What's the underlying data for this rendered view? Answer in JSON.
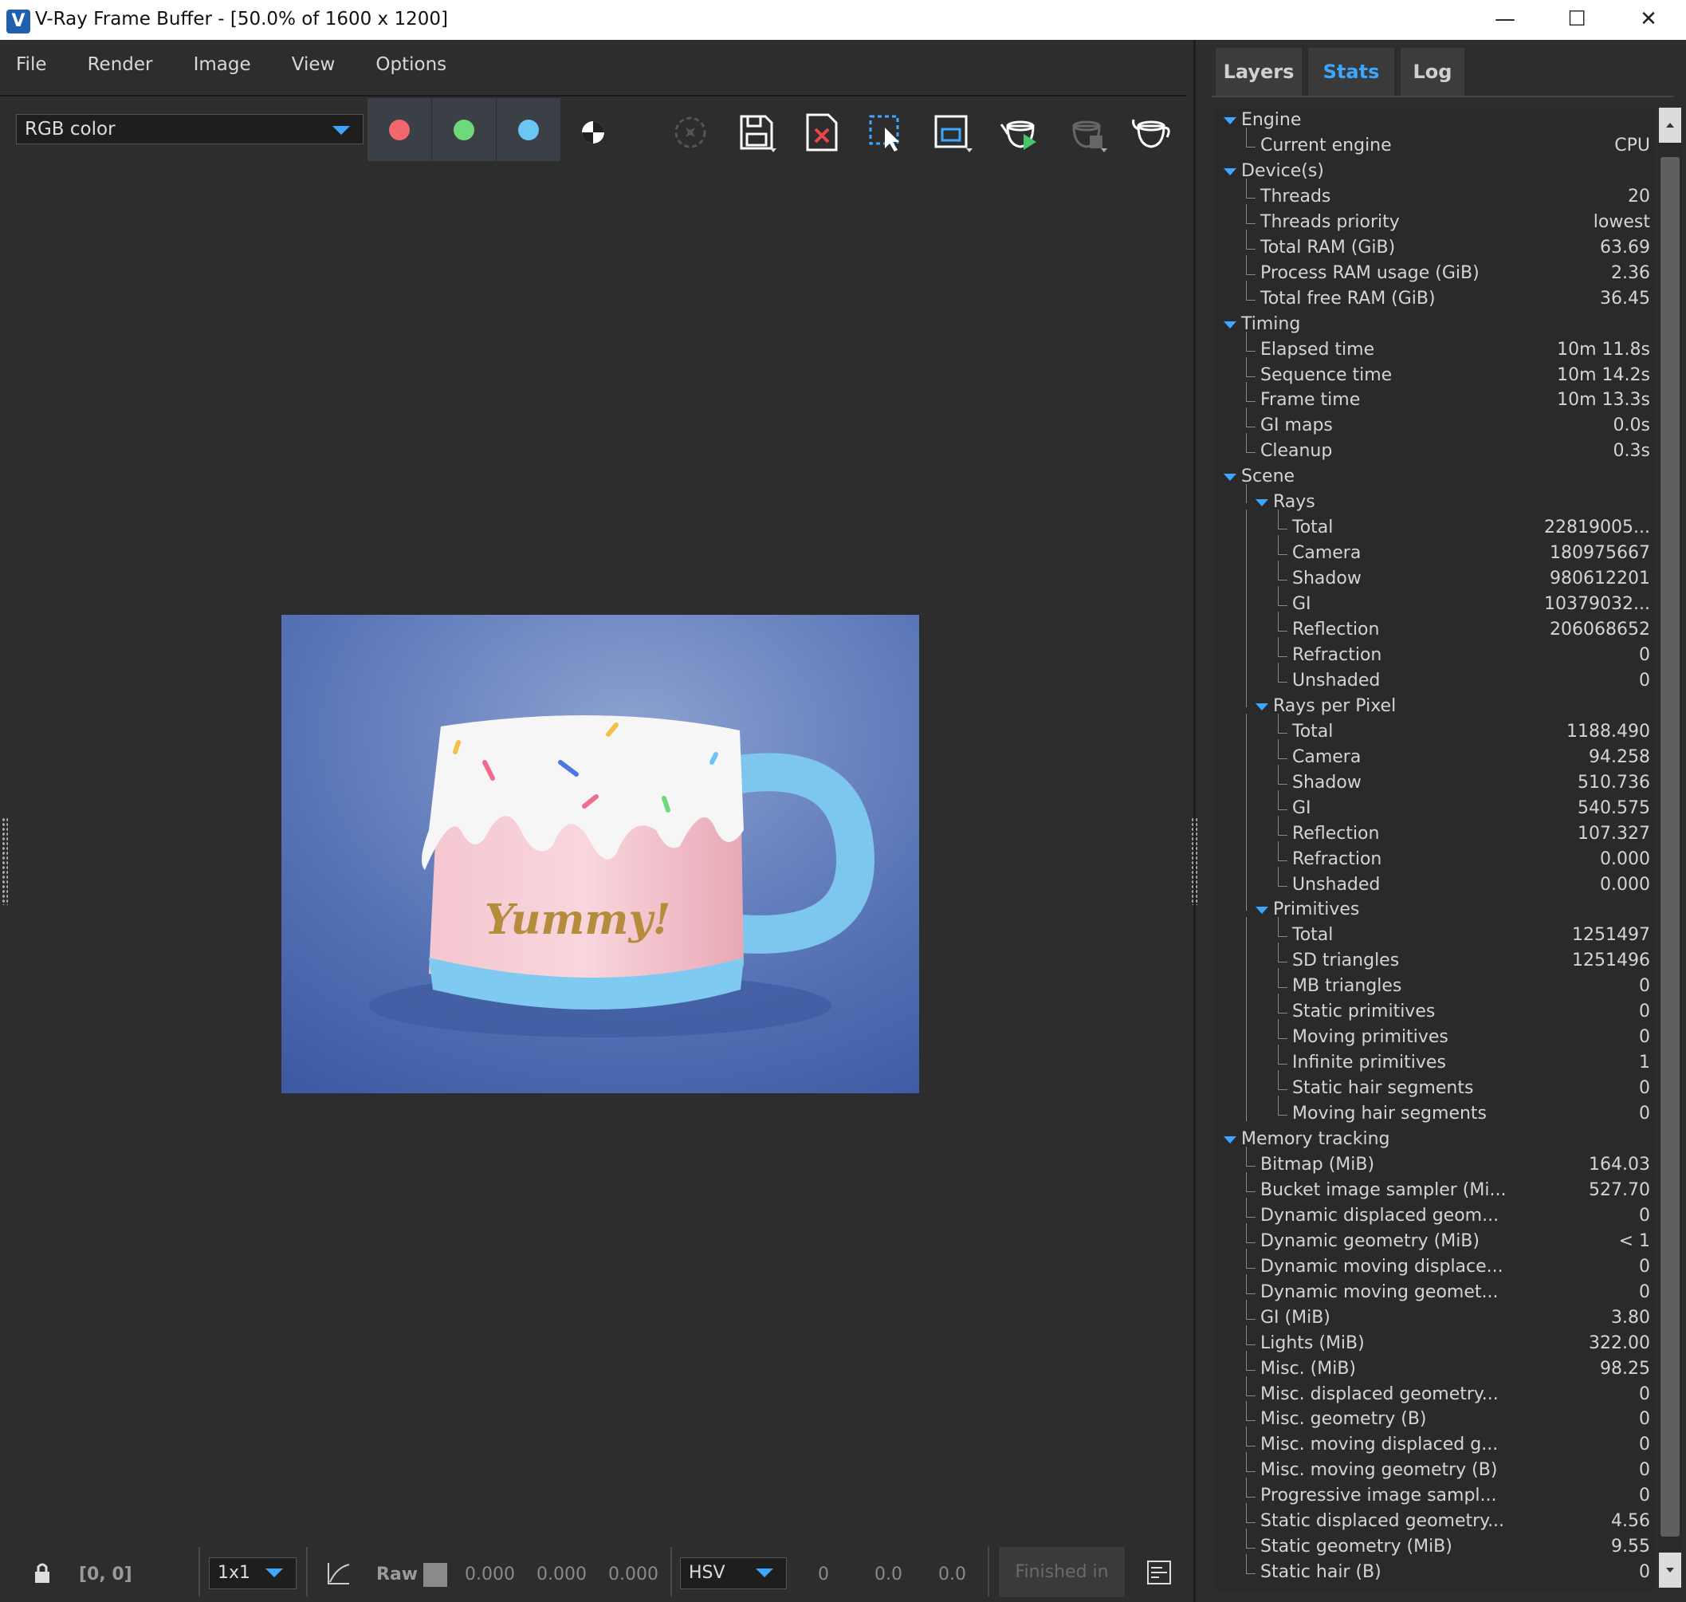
{
  "window": {
    "title": "V-Ray Frame Buffer - [50.0% of 1600 x 1200]",
    "minimize": "—",
    "maximize": "☐",
    "close": "✕"
  },
  "menu": [
    "File",
    "Render",
    "Image",
    "View",
    "Options"
  ],
  "toolbar": {
    "channel": "RGB color",
    "colors": {
      "red": "#f0686c",
      "green": "#6ed87a",
      "blue": "#6cc6f4"
    },
    "icons": [
      "mono-icon",
      "lens-effects-icon",
      "save-icon",
      "clear-icon",
      "region-select-icon",
      "region-render-icon",
      "render-interactive-icon",
      "render-stop-icon",
      "render-icon"
    ]
  },
  "render_image": {
    "text": "Yummy!"
  },
  "status": {
    "coords": "[0, 0]",
    "zoom": "1x1",
    "raw_label": "Raw",
    "r": "0.000",
    "g": "0.000",
    "b": "0.000",
    "color_mode": "HSV",
    "h": "0",
    "s": "0.0",
    "v": "0.0",
    "finished": "Finished in"
  },
  "tabs": [
    {
      "label": "Layers",
      "active": false
    },
    {
      "label": "Stats",
      "active": true
    },
    {
      "label": "Log",
      "active": false
    }
  ],
  "stats": [
    {
      "label": "Engine",
      "value": "",
      "level": 0,
      "group": true
    },
    {
      "label": "Current engine",
      "value": "CPU",
      "level": 1
    },
    {
      "label": "Device(s)",
      "value": "",
      "level": 0,
      "group": true
    },
    {
      "label": "Threads",
      "value": "20",
      "level": 1
    },
    {
      "label": "Threads priority",
      "value": "lowest",
      "level": 1
    },
    {
      "label": "Total RAM (GiB)",
      "value": "63.69",
      "level": 1
    },
    {
      "label": "Process RAM usage (GiB)",
      "value": "2.36",
      "level": 1
    },
    {
      "label": "Total free RAM (GiB)",
      "value": "36.45",
      "level": 1
    },
    {
      "label": "Timing",
      "value": "",
      "level": 0,
      "group": true
    },
    {
      "label": "Elapsed time",
      "value": "10m 11.8s",
      "level": 1
    },
    {
      "label": "Sequence time",
      "value": "10m 14.2s",
      "level": 1
    },
    {
      "label": "Frame time",
      "value": "10m 13.3s",
      "level": 1
    },
    {
      "label": "GI maps",
      "value": "0.0s",
      "level": 1
    },
    {
      "label": "Cleanup",
      "value": "0.3s",
      "level": 1
    },
    {
      "label": "Scene",
      "value": "",
      "level": 0,
      "group": true
    },
    {
      "label": "Rays",
      "value": "",
      "level": 1,
      "group": true
    },
    {
      "label": "Total",
      "value": "22819005...",
      "level": 2
    },
    {
      "label": "Camera",
      "value": "180975667",
      "level": 2
    },
    {
      "label": "Shadow",
      "value": "980612201",
      "level": 2
    },
    {
      "label": "GI",
      "value": "10379032...",
      "level": 2
    },
    {
      "label": "Reflection",
      "value": "206068652",
      "level": 2
    },
    {
      "label": "Refraction",
      "value": "0",
      "level": 2
    },
    {
      "label": "Unshaded",
      "value": "0",
      "level": 2
    },
    {
      "label": "Rays per Pixel",
      "value": "",
      "level": 1,
      "group": true
    },
    {
      "label": "Total",
      "value": "1188.490",
      "level": 2
    },
    {
      "label": "Camera",
      "value": "94.258",
      "level": 2
    },
    {
      "label": "Shadow",
      "value": "510.736",
      "level": 2
    },
    {
      "label": "GI",
      "value": "540.575",
      "level": 2
    },
    {
      "label": "Reflection",
      "value": "107.327",
      "level": 2
    },
    {
      "label": "Refraction",
      "value": "0.000",
      "level": 2
    },
    {
      "label": "Unshaded",
      "value": "0.000",
      "level": 2
    },
    {
      "label": "Primitives",
      "value": "",
      "level": 1,
      "group": true
    },
    {
      "label": "Total",
      "value": "1251497",
      "level": 2
    },
    {
      "label": "SD triangles",
      "value": "1251496",
      "level": 2
    },
    {
      "label": "MB triangles",
      "value": "0",
      "level": 2
    },
    {
      "label": "Static primitives",
      "value": "0",
      "level": 2
    },
    {
      "label": "Moving primitives",
      "value": "0",
      "level": 2
    },
    {
      "label": "Infinite primitives",
      "value": "1",
      "level": 2
    },
    {
      "label": "Static hair segments",
      "value": "0",
      "level": 2
    },
    {
      "label": "Moving hair segments",
      "value": "0",
      "level": 2
    },
    {
      "label": "Memory tracking",
      "value": "",
      "level": 0,
      "group": true
    },
    {
      "label": "Bitmap (MiB)",
      "value": "164.03",
      "level": 1
    },
    {
      "label": "Bucket image sampler (Mi...",
      "value": "527.70",
      "level": 1
    },
    {
      "label": "Dynamic displaced geom...",
      "value": "0",
      "level": 1
    },
    {
      "label": "Dynamic geometry (MiB)",
      "value": "< 1",
      "level": 1
    },
    {
      "label": "Dynamic moving displace...",
      "value": "0",
      "level": 1
    },
    {
      "label": "Dynamic moving geomet...",
      "value": "0",
      "level": 1
    },
    {
      "label": "GI (MiB)",
      "value": "3.80",
      "level": 1
    },
    {
      "label": "Lights (MiB)",
      "value": "322.00",
      "level": 1
    },
    {
      "label": "Misc. (MiB)",
      "value": "98.25",
      "level": 1
    },
    {
      "label": "Misc. displaced geometry...",
      "value": "0",
      "level": 1
    },
    {
      "label": "Misc. geometry (B)",
      "value": "0",
      "level": 1
    },
    {
      "label": "Misc. moving displaced g...",
      "value": "0",
      "level": 1
    },
    {
      "label": "Misc. moving geometry (B)",
      "value": "0",
      "level": 1
    },
    {
      "label": "Progressive image sampl...",
      "value": "0",
      "level": 1
    },
    {
      "label": "Static displaced geometry...",
      "value": "4.56",
      "level": 1
    },
    {
      "label": "Static geometry (MiB)",
      "value": "9.55",
      "level": 1
    },
    {
      "label": "Static hair (B)",
      "value": "0",
      "level": 1
    }
  ]
}
